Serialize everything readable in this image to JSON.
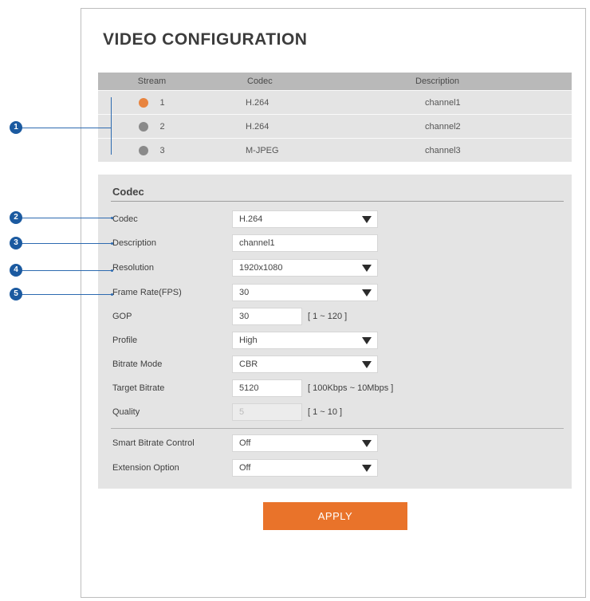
{
  "page": {
    "title": "VIDEO CONFIGURATION"
  },
  "stream_table": {
    "headers": [
      "Stream",
      "Codec",
      "Description"
    ],
    "rows": [
      {
        "stream": "1",
        "codec": "H.264",
        "description": "channel1",
        "selected": true
      },
      {
        "stream": "2",
        "codec": "H.264",
        "description": "channel2",
        "selected": false
      },
      {
        "stream": "3",
        "codec": "M-JPEG",
        "description": "channel3",
        "selected": false
      }
    ]
  },
  "codec_panel": {
    "title": "Codec",
    "codec": {
      "label": "Codec",
      "value": "H.264"
    },
    "description": {
      "label": "Description",
      "value": "channel1"
    },
    "resolution": {
      "label": "Resolution",
      "value": "1920x1080"
    },
    "frame_rate": {
      "label": "Frame Rate(FPS)",
      "value": "30"
    },
    "gop": {
      "label": "GOP",
      "value": "30",
      "range": "[ 1 ~ 120 ]"
    },
    "profile": {
      "label": "Profile",
      "value": "High"
    },
    "bitrate_mode": {
      "label": "Bitrate Mode",
      "value": "CBR"
    },
    "target_bitrate": {
      "label": "Target Bitrate",
      "value": "5120",
      "range": "[ 100Kbps ~ 10Mbps ]"
    },
    "quality": {
      "label": "Quality",
      "value": "5",
      "range": "[ 1 ~ 10 ]"
    },
    "smart_bitrate": {
      "label": "Smart Bitrate Control",
      "value": "Off"
    },
    "extension": {
      "label": "Extension Option",
      "value": "Off"
    }
  },
  "apply_label": "APPLY",
  "callouts": [
    "1",
    "2",
    "3",
    "4",
    "5"
  ],
  "colors": {
    "accent": "#e9732a",
    "callout": "#1b5aa0",
    "panel": "#e4e4e4",
    "header": "#b9b9b9"
  }
}
